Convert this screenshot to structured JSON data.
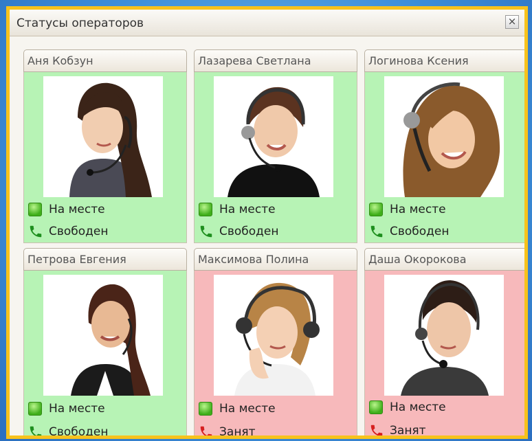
{
  "window": {
    "title": "Статусы операторов",
    "close_symbol": "×"
  },
  "colors": {
    "available_bg": "#b7f3b5",
    "busy_bg": "#f7b9bb",
    "phone_free": "#1e8f1e",
    "phone_busy": "#d61f1f"
  },
  "operators": [
    {
      "name": "Аня Кобзун",
      "presence": "На месте",
      "call_status": "Свободен",
      "state": "free"
    },
    {
      "name": "Лазарева Светлана",
      "presence": "На месте",
      "call_status": "Свободен",
      "state": "free"
    },
    {
      "name": "Логинова Ксения",
      "presence": "На месте",
      "call_status": "Свободен",
      "state": "free"
    },
    {
      "name": "Петрова Евгения",
      "presence": "На месте",
      "call_status": "Свободен",
      "state": "free"
    },
    {
      "name": "Максимова Полина",
      "presence": "На месте",
      "call_status": "Занят",
      "state": "busy"
    },
    {
      "name": "Даша Окорокова",
      "presence": "На месте",
      "call_status": "Занят",
      "state": "busy"
    }
  ]
}
